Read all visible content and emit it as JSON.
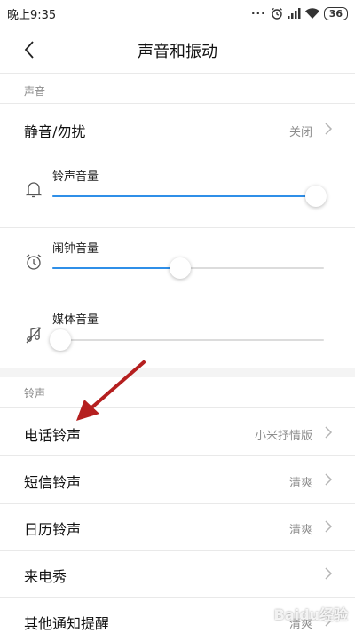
{
  "status_bar": {
    "time": "晚上9:35",
    "dots": "···",
    "battery": "36"
  },
  "header": {
    "title": "声音和振动"
  },
  "sections": {
    "sound": {
      "label": "声音"
    },
    "ringtone": {
      "label": "铃声"
    }
  },
  "sound": {
    "silent": {
      "label": "静音/勿扰",
      "value": "关闭"
    },
    "volumes": [
      {
        "label": "铃声音量",
        "icon": "bell-icon",
        "level": 0.97
      },
      {
        "label": "闹钟音量",
        "icon": "alarm-clock-icon",
        "level": 0.47
      },
      {
        "label": "媒体音量",
        "icon": "music-note-muted-icon",
        "level": 0.03
      }
    ]
  },
  "ringtones": [
    {
      "label": "电话铃声",
      "value": "小米抒情版"
    },
    {
      "label": "短信铃声",
      "value": "清爽"
    },
    {
      "label": "日历铃声",
      "value": "清爽"
    },
    {
      "label": "来电秀",
      "value": ""
    },
    {
      "label": "其他通知提醒",
      "value": "清爽"
    }
  ],
  "watermark": {
    "text": "Baidu经验"
  },
  "colors": {
    "accent": "#2f8fe8",
    "annotation_arrow": "#b51f1f"
  }
}
